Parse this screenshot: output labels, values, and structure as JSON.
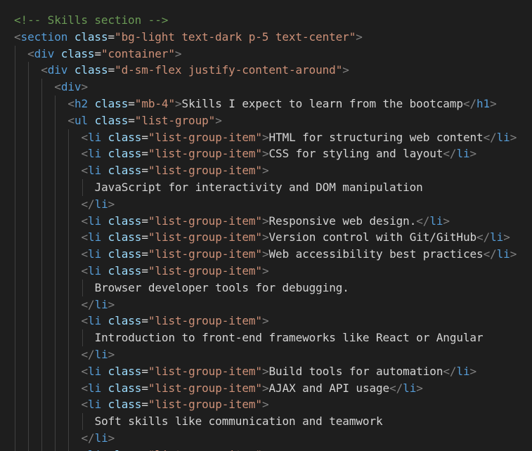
{
  "colors": {
    "background": "#1e1e1e",
    "comment": "#6a9955",
    "bracket": "#808080",
    "tag": "#569cd6",
    "attribute": "#9cdcfe",
    "string": "#ce9178",
    "text": "#d4d4d4",
    "indent_guide": "#404040"
  },
  "lines": [
    {
      "indent": 0,
      "tokens": [
        {
          "t": "comment",
          "v": "<!-- Skills section -->"
        }
      ]
    },
    {
      "indent": 0,
      "tokens": [
        {
          "t": "bracket",
          "v": "<"
        },
        {
          "t": "tag",
          "v": "section"
        },
        {
          "t": "text",
          "v": " "
        },
        {
          "t": "attr",
          "v": "class"
        },
        {
          "t": "eq",
          "v": "="
        },
        {
          "t": "str",
          "v": "\"bg-light text-dark p-5 text-center\""
        },
        {
          "t": "bracket",
          "v": ">"
        }
      ]
    },
    {
      "indent": 1,
      "tokens": [
        {
          "t": "bracket",
          "v": "<"
        },
        {
          "t": "tag",
          "v": "div"
        },
        {
          "t": "text",
          "v": " "
        },
        {
          "t": "attr",
          "v": "class"
        },
        {
          "t": "eq",
          "v": "="
        },
        {
          "t": "str",
          "v": "\"container\""
        },
        {
          "t": "bracket",
          "v": ">"
        }
      ]
    },
    {
      "indent": 2,
      "tokens": [
        {
          "t": "bracket",
          "v": "<"
        },
        {
          "t": "tag",
          "v": "div"
        },
        {
          "t": "text",
          "v": " "
        },
        {
          "t": "attr",
          "v": "class"
        },
        {
          "t": "eq",
          "v": "="
        },
        {
          "t": "str",
          "v": "\"d-sm-flex justify-content-around\""
        },
        {
          "t": "bracket",
          "v": ">"
        }
      ]
    },
    {
      "indent": 3,
      "tokens": [
        {
          "t": "bracket",
          "v": "<"
        },
        {
          "t": "tag",
          "v": "div"
        },
        {
          "t": "bracket",
          "v": ">"
        }
      ]
    },
    {
      "indent": 4,
      "tokens": [
        {
          "t": "bracket",
          "v": "<"
        },
        {
          "t": "tag",
          "v": "h2"
        },
        {
          "t": "text",
          "v": " "
        },
        {
          "t": "attr",
          "v": "class"
        },
        {
          "t": "eq",
          "v": "="
        },
        {
          "t": "str",
          "v": "\"mb-4\""
        },
        {
          "t": "bracket",
          "v": ">"
        },
        {
          "t": "text",
          "v": "Skills I expect to learn from the bootcamp"
        },
        {
          "t": "bracket",
          "v": "</"
        },
        {
          "t": "tag",
          "v": "h1"
        },
        {
          "t": "bracket",
          "v": ">"
        }
      ]
    },
    {
      "indent": 4,
      "tokens": [
        {
          "t": "bracket",
          "v": "<"
        },
        {
          "t": "tag",
          "v": "ul"
        },
        {
          "t": "text",
          "v": " "
        },
        {
          "t": "attr",
          "v": "class"
        },
        {
          "t": "eq",
          "v": "="
        },
        {
          "t": "str",
          "v": "\"list-group\""
        },
        {
          "t": "bracket",
          "v": ">"
        }
      ]
    },
    {
      "indent": 5,
      "tokens": [
        {
          "t": "bracket",
          "v": "<"
        },
        {
          "t": "tag",
          "v": "li"
        },
        {
          "t": "text",
          "v": " "
        },
        {
          "t": "attr",
          "v": "class"
        },
        {
          "t": "eq",
          "v": "="
        },
        {
          "t": "str",
          "v": "\"list-group-item\""
        },
        {
          "t": "bracket",
          "v": ">"
        },
        {
          "t": "text",
          "v": "HTML for structuring web content"
        },
        {
          "t": "bracket",
          "v": "</"
        },
        {
          "t": "tag",
          "v": "li"
        },
        {
          "t": "bracket",
          "v": ">"
        }
      ]
    },
    {
      "indent": 5,
      "tokens": [
        {
          "t": "bracket",
          "v": "<"
        },
        {
          "t": "tag",
          "v": "li"
        },
        {
          "t": "text",
          "v": " "
        },
        {
          "t": "attr",
          "v": "class"
        },
        {
          "t": "eq",
          "v": "="
        },
        {
          "t": "str",
          "v": "\"list-group-item\""
        },
        {
          "t": "bracket",
          "v": ">"
        },
        {
          "t": "text",
          "v": "CSS for styling and layout"
        },
        {
          "t": "bracket",
          "v": "</"
        },
        {
          "t": "tag",
          "v": "li"
        },
        {
          "t": "bracket",
          "v": ">"
        }
      ]
    },
    {
      "indent": 5,
      "tokens": [
        {
          "t": "bracket",
          "v": "<"
        },
        {
          "t": "tag",
          "v": "li"
        },
        {
          "t": "text",
          "v": " "
        },
        {
          "t": "attr",
          "v": "class"
        },
        {
          "t": "eq",
          "v": "="
        },
        {
          "t": "str",
          "v": "\"list-group-item\""
        },
        {
          "t": "bracket",
          "v": ">"
        }
      ]
    },
    {
      "indent": 6,
      "tokens": [
        {
          "t": "text",
          "v": "JavaScript for interactivity and DOM manipulation"
        }
      ]
    },
    {
      "indent": 5,
      "tokens": [
        {
          "t": "bracket",
          "v": "</"
        },
        {
          "t": "tag",
          "v": "li"
        },
        {
          "t": "bracket",
          "v": ">"
        }
      ]
    },
    {
      "indent": 5,
      "tokens": [
        {
          "t": "bracket",
          "v": "<"
        },
        {
          "t": "tag",
          "v": "li"
        },
        {
          "t": "text",
          "v": " "
        },
        {
          "t": "attr",
          "v": "class"
        },
        {
          "t": "eq",
          "v": "="
        },
        {
          "t": "str",
          "v": "\"list-group-item\""
        },
        {
          "t": "bracket",
          "v": ">"
        },
        {
          "t": "text",
          "v": "Responsive web design."
        },
        {
          "t": "bracket",
          "v": "</"
        },
        {
          "t": "tag",
          "v": "li"
        },
        {
          "t": "bracket",
          "v": ">"
        }
      ]
    },
    {
      "indent": 5,
      "tokens": [
        {
          "t": "bracket",
          "v": "<"
        },
        {
          "t": "tag",
          "v": "li"
        },
        {
          "t": "text",
          "v": " "
        },
        {
          "t": "attr",
          "v": "class"
        },
        {
          "t": "eq",
          "v": "="
        },
        {
          "t": "str",
          "v": "\"list-group-item\""
        },
        {
          "t": "bracket",
          "v": ">"
        },
        {
          "t": "text",
          "v": "Version control with Git/GitHub"
        },
        {
          "t": "bracket",
          "v": "</"
        },
        {
          "t": "tag",
          "v": "li"
        },
        {
          "t": "bracket",
          "v": ">"
        }
      ]
    },
    {
      "indent": 5,
      "tokens": [
        {
          "t": "bracket",
          "v": "<"
        },
        {
          "t": "tag",
          "v": "li"
        },
        {
          "t": "text",
          "v": " "
        },
        {
          "t": "attr",
          "v": "class"
        },
        {
          "t": "eq",
          "v": "="
        },
        {
          "t": "str",
          "v": "\"list-group-item\""
        },
        {
          "t": "bracket",
          "v": ">"
        },
        {
          "t": "text",
          "v": "Web accessibility best practices"
        },
        {
          "t": "bracket",
          "v": "</"
        },
        {
          "t": "tag",
          "v": "li"
        },
        {
          "t": "bracket",
          "v": ">"
        }
      ]
    },
    {
      "indent": 5,
      "tokens": [
        {
          "t": "bracket",
          "v": "<"
        },
        {
          "t": "tag",
          "v": "li"
        },
        {
          "t": "text",
          "v": " "
        },
        {
          "t": "attr",
          "v": "class"
        },
        {
          "t": "eq",
          "v": "="
        },
        {
          "t": "str",
          "v": "\"list-group-item\""
        },
        {
          "t": "bracket",
          "v": ">"
        }
      ]
    },
    {
      "indent": 6,
      "tokens": [
        {
          "t": "text",
          "v": "Browser developer tools for debugging."
        }
      ]
    },
    {
      "indent": 5,
      "tokens": [
        {
          "t": "bracket",
          "v": "</"
        },
        {
          "t": "tag",
          "v": "li"
        },
        {
          "t": "bracket",
          "v": ">"
        }
      ]
    },
    {
      "indent": 5,
      "tokens": [
        {
          "t": "bracket",
          "v": "<"
        },
        {
          "t": "tag",
          "v": "li"
        },
        {
          "t": "text",
          "v": " "
        },
        {
          "t": "attr",
          "v": "class"
        },
        {
          "t": "eq",
          "v": "="
        },
        {
          "t": "str",
          "v": "\"list-group-item\""
        },
        {
          "t": "bracket",
          "v": ">"
        }
      ]
    },
    {
      "indent": 6,
      "tokens": [
        {
          "t": "text",
          "v": "Introduction to front-end frameworks like React or Angular"
        }
      ]
    },
    {
      "indent": 5,
      "tokens": [
        {
          "t": "bracket",
          "v": "</"
        },
        {
          "t": "tag",
          "v": "li"
        },
        {
          "t": "bracket",
          "v": ">"
        }
      ]
    },
    {
      "indent": 5,
      "tokens": [
        {
          "t": "bracket",
          "v": "<"
        },
        {
          "t": "tag",
          "v": "li"
        },
        {
          "t": "text",
          "v": " "
        },
        {
          "t": "attr",
          "v": "class"
        },
        {
          "t": "eq",
          "v": "="
        },
        {
          "t": "str",
          "v": "\"list-group-item\""
        },
        {
          "t": "bracket",
          "v": ">"
        },
        {
          "t": "text",
          "v": "Build tools for automation"
        },
        {
          "t": "bracket",
          "v": "</"
        },
        {
          "t": "tag",
          "v": "li"
        },
        {
          "t": "bracket",
          "v": ">"
        }
      ]
    },
    {
      "indent": 5,
      "tokens": [
        {
          "t": "bracket",
          "v": "<"
        },
        {
          "t": "tag",
          "v": "li"
        },
        {
          "t": "text",
          "v": " "
        },
        {
          "t": "attr",
          "v": "class"
        },
        {
          "t": "eq",
          "v": "="
        },
        {
          "t": "str",
          "v": "\"list-group-item\""
        },
        {
          "t": "bracket",
          "v": ">"
        },
        {
          "t": "text",
          "v": "AJAX and API usage"
        },
        {
          "t": "bracket",
          "v": "</"
        },
        {
          "t": "tag",
          "v": "li"
        },
        {
          "t": "bracket",
          "v": ">"
        }
      ]
    },
    {
      "indent": 5,
      "tokens": [
        {
          "t": "bracket",
          "v": "<"
        },
        {
          "t": "tag",
          "v": "li"
        },
        {
          "t": "text",
          "v": " "
        },
        {
          "t": "attr",
          "v": "class"
        },
        {
          "t": "eq",
          "v": "="
        },
        {
          "t": "str",
          "v": "\"list-group-item\""
        },
        {
          "t": "bracket",
          "v": ">"
        }
      ]
    },
    {
      "indent": 6,
      "tokens": [
        {
          "t": "text",
          "v": "Soft skills like communication and teamwork"
        }
      ]
    },
    {
      "indent": 5,
      "tokens": [
        {
          "t": "bracket",
          "v": "</"
        },
        {
          "t": "tag",
          "v": "li"
        },
        {
          "t": "bracket",
          "v": ">"
        }
      ]
    },
    {
      "indent": 5,
      "tokens": [
        {
          "t": "bracket",
          "v": "<"
        },
        {
          "t": "tag",
          "v": "li"
        },
        {
          "t": "text",
          "v": " "
        },
        {
          "t": "attr",
          "v": "class"
        },
        {
          "t": "eq",
          "v": "="
        },
        {
          "t": "str",
          "v": "\"list-group-item\""
        },
        {
          "t": "bracket",
          "v": ">"
        }
      ]
    }
  ]
}
